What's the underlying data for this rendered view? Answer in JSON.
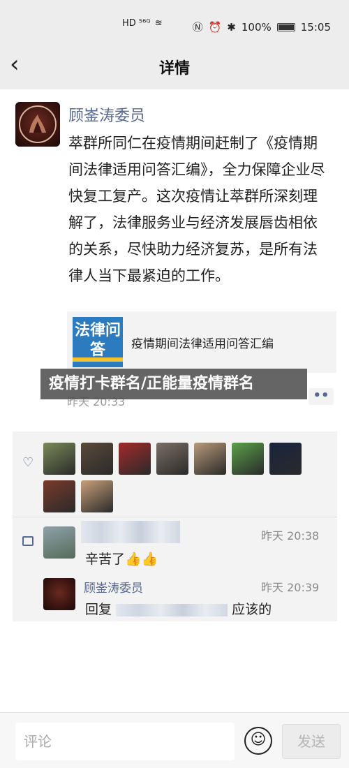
{
  "status": {
    "network": "HD ⁵⁶ᴳ",
    "battery": "100%",
    "time": "15:05"
  },
  "nav": {
    "title": "详情"
  },
  "post": {
    "author": "顾崟涛委员",
    "text": "萃群所同仁在疫情期间赶制了《疫情期间法律适用问答汇编》，全力保障企业尽快复工复产。这次疫情让萃群所深刻理解了，法律服务业与经济发展唇齿相依的关系，尽快助力经济复苏，是所有法律人当下最紧迫的工作。",
    "link": {
      "thumb_text": "法律问答",
      "title": "疫情期间法律适用问答汇编"
    },
    "time": "昨天 20:33",
    "more": "••"
  },
  "banner": "疫情打卡群名/正能量疫情群名",
  "likes": {
    "avatar_colors": [
      "#7a8a58",
      "#5a4a3a",
      "#a32a2a",
      "#7a6f66",
      "#b89a7a",
      "#5aa04a",
      "#1a2440",
      "#7a3a2a",
      "#c9a07a"
    ]
  },
  "comments": [
    {
      "time": "昨天 20:38",
      "text": "辛苦了👍👍"
    },
    {
      "name": "顾崟涛委员",
      "time": "昨天 20:39",
      "prefix": "回复",
      "suffix": "应该的"
    }
  ],
  "bottom": {
    "placeholder": "评论",
    "emoji": "☺",
    "send": "发送"
  }
}
